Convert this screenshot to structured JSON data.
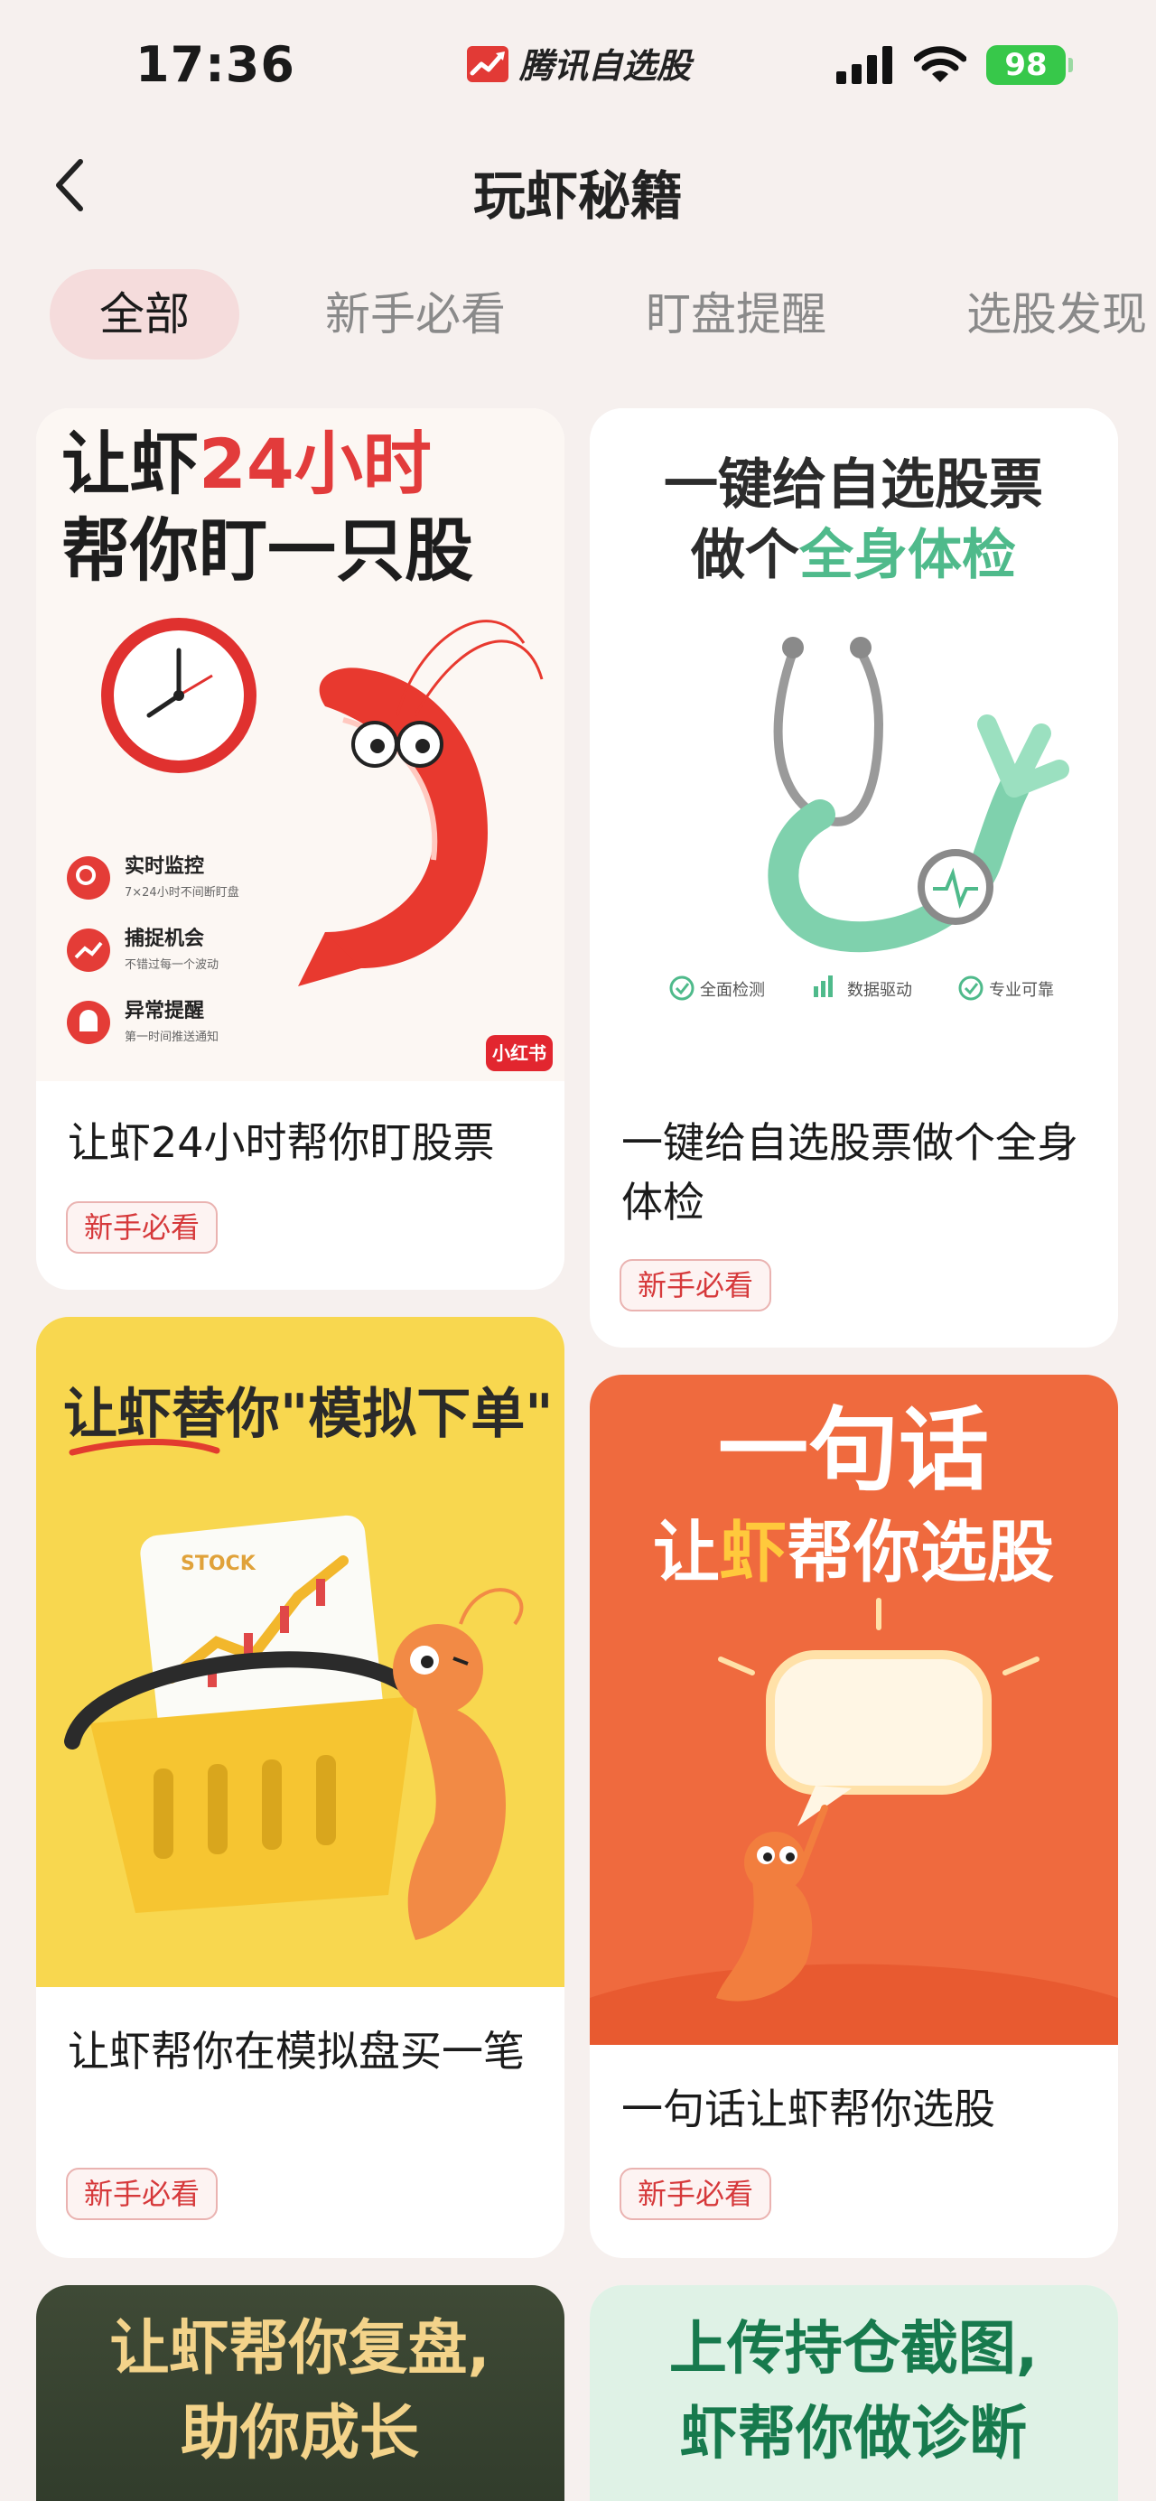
{
  "status_bar": {
    "time": "17:36",
    "app_name": "腾讯自选股",
    "battery": "98",
    "icons": [
      "signal-icon",
      "wifi-icon",
      "battery-icon"
    ]
  },
  "nav": {
    "title": "玩虾秘籍",
    "back_icon": "chevron-left-icon"
  },
  "tabs": [
    {
      "label": "全部",
      "active": true
    },
    {
      "label": "新手必看",
      "active": false
    },
    {
      "label": "盯盘提醒",
      "active": false
    },
    {
      "label": "选股发现",
      "active": false
    }
  ],
  "colors": {
    "accent_red": "#d6393b",
    "tab_active_bg": "#f5dcdc",
    "page_bg": "#f6f0ee",
    "tag_border": "#eab3b1"
  },
  "cards": [
    {
      "title": "让虾24小时帮你盯股票",
      "tag": "新手必看",
      "image": {
        "headline_line1_a": "让虾",
        "headline_line1_b": "24小时",
        "headline_line2": "帮你盯一只股",
        "features": [
          {
            "title": "实时监控",
            "subtitle": "7×24小时不间断盯盘"
          },
          {
            "title": "捕捉机会",
            "subtitle": "不错过每一个波动"
          },
          {
            "title": "异常提醒",
            "subtitle": "第一时间推送通知"
          }
        ],
        "badge": "小红书"
      }
    },
    {
      "title": "一键给自选股票做个全身体检",
      "tag": "新手必看",
      "image": {
        "headline_line1": "一键给自选股票",
        "headline_line2_a": "做个",
        "headline_line2_b": "全身体检",
        "features": [
          "全面检测",
          "数据驱动",
          "专业可靠"
        ]
      }
    },
    {
      "title": "让虾帮你在模拟盘买一笔",
      "tag": "新手必看",
      "image": {
        "headline_a": "让虾替你",
        "headline_b": "\"模拟下单\"",
        "chart_label": "STOCK"
      }
    },
    {
      "title": "一句话让虾帮你选股",
      "tag": "新手必看",
      "image": {
        "headline_line1": "一句话",
        "headline_line2_a": "让",
        "headline_line2_b": "虾",
        "headline_line2_c": "帮你选股"
      }
    },
    {
      "image": {
        "headline_line1": "让虾帮你复盘,",
        "headline_line2": "助你成长"
      }
    },
    {
      "image": {
        "headline_line1": "上传持仓截图,",
        "headline_line2": "虾帮你做诊断"
      }
    }
  ]
}
